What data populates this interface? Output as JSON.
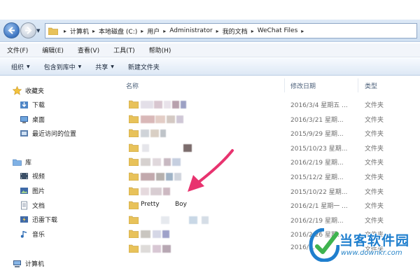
{
  "address_bar": {
    "crumbs": [
      "计算机",
      "本地磁盘 (C:)",
      "用户",
      "Administrator",
      "我的文档",
      "WeChat Files"
    ]
  },
  "menu": {
    "items": [
      "文件(F)",
      "编辑(E)",
      "查看(V)",
      "工具(T)",
      "帮助(H)"
    ]
  },
  "toolbar": {
    "organize": "组织",
    "include_library": "包含到库中",
    "share": "共享",
    "new_folder": "新建文件夹"
  },
  "nav_pane": {
    "favorites": "收藏夹",
    "downloads": "下载",
    "desktop": "桌面",
    "recent": "最近访问的位置",
    "libraries": "库",
    "videos": "视频",
    "pictures": "图片",
    "documents": "文档",
    "thunder": "迅雷下载",
    "music": "音乐",
    "computer": "计算机"
  },
  "columns": {
    "name": "名称",
    "date": "修改日期",
    "type": "类型"
  },
  "rows": [
    {
      "date": "2016/3/4 星期五 ...",
      "type": "文件夹"
    },
    {
      "date": "2016/3/21 星期...",
      "type": "文件夹"
    },
    {
      "date": "2015/9/29 星期...",
      "type": "文件夹"
    },
    {
      "date": "2015/10/23 星期...",
      "type": "文件夹"
    },
    {
      "date": "2016/2/19 星期...",
      "type": "文件夹"
    },
    {
      "date": "2015/12/2 星期...",
      "type": "文件夹"
    },
    {
      "date": "2015/10/22 星期...",
      "type": "文件夹"
    },
    {
      "date": "2016/2/1 星期一 ...",
      "type": "文件夹",
      "name_parts": [
        "Pretty",
        "Boy"
      ]
    },
    {
      "date": "2016/2/19 星期...",
      "type": "文件夹"
    },
    {
      "date": "2016/2/26 星期...",
      "type": "文件夹"
    },
    {
      "date": "2016/...",
      "type": "文件夹"
    }
  ],
  "watermark": {
    "title": "当客软件园",
    "url": "www.downkr.com"
  },
  "colors": {
    "accent": "#1f7fce",
    "arrow": "#e8336f",
    "folder": "#e8c25a"
  }
}
